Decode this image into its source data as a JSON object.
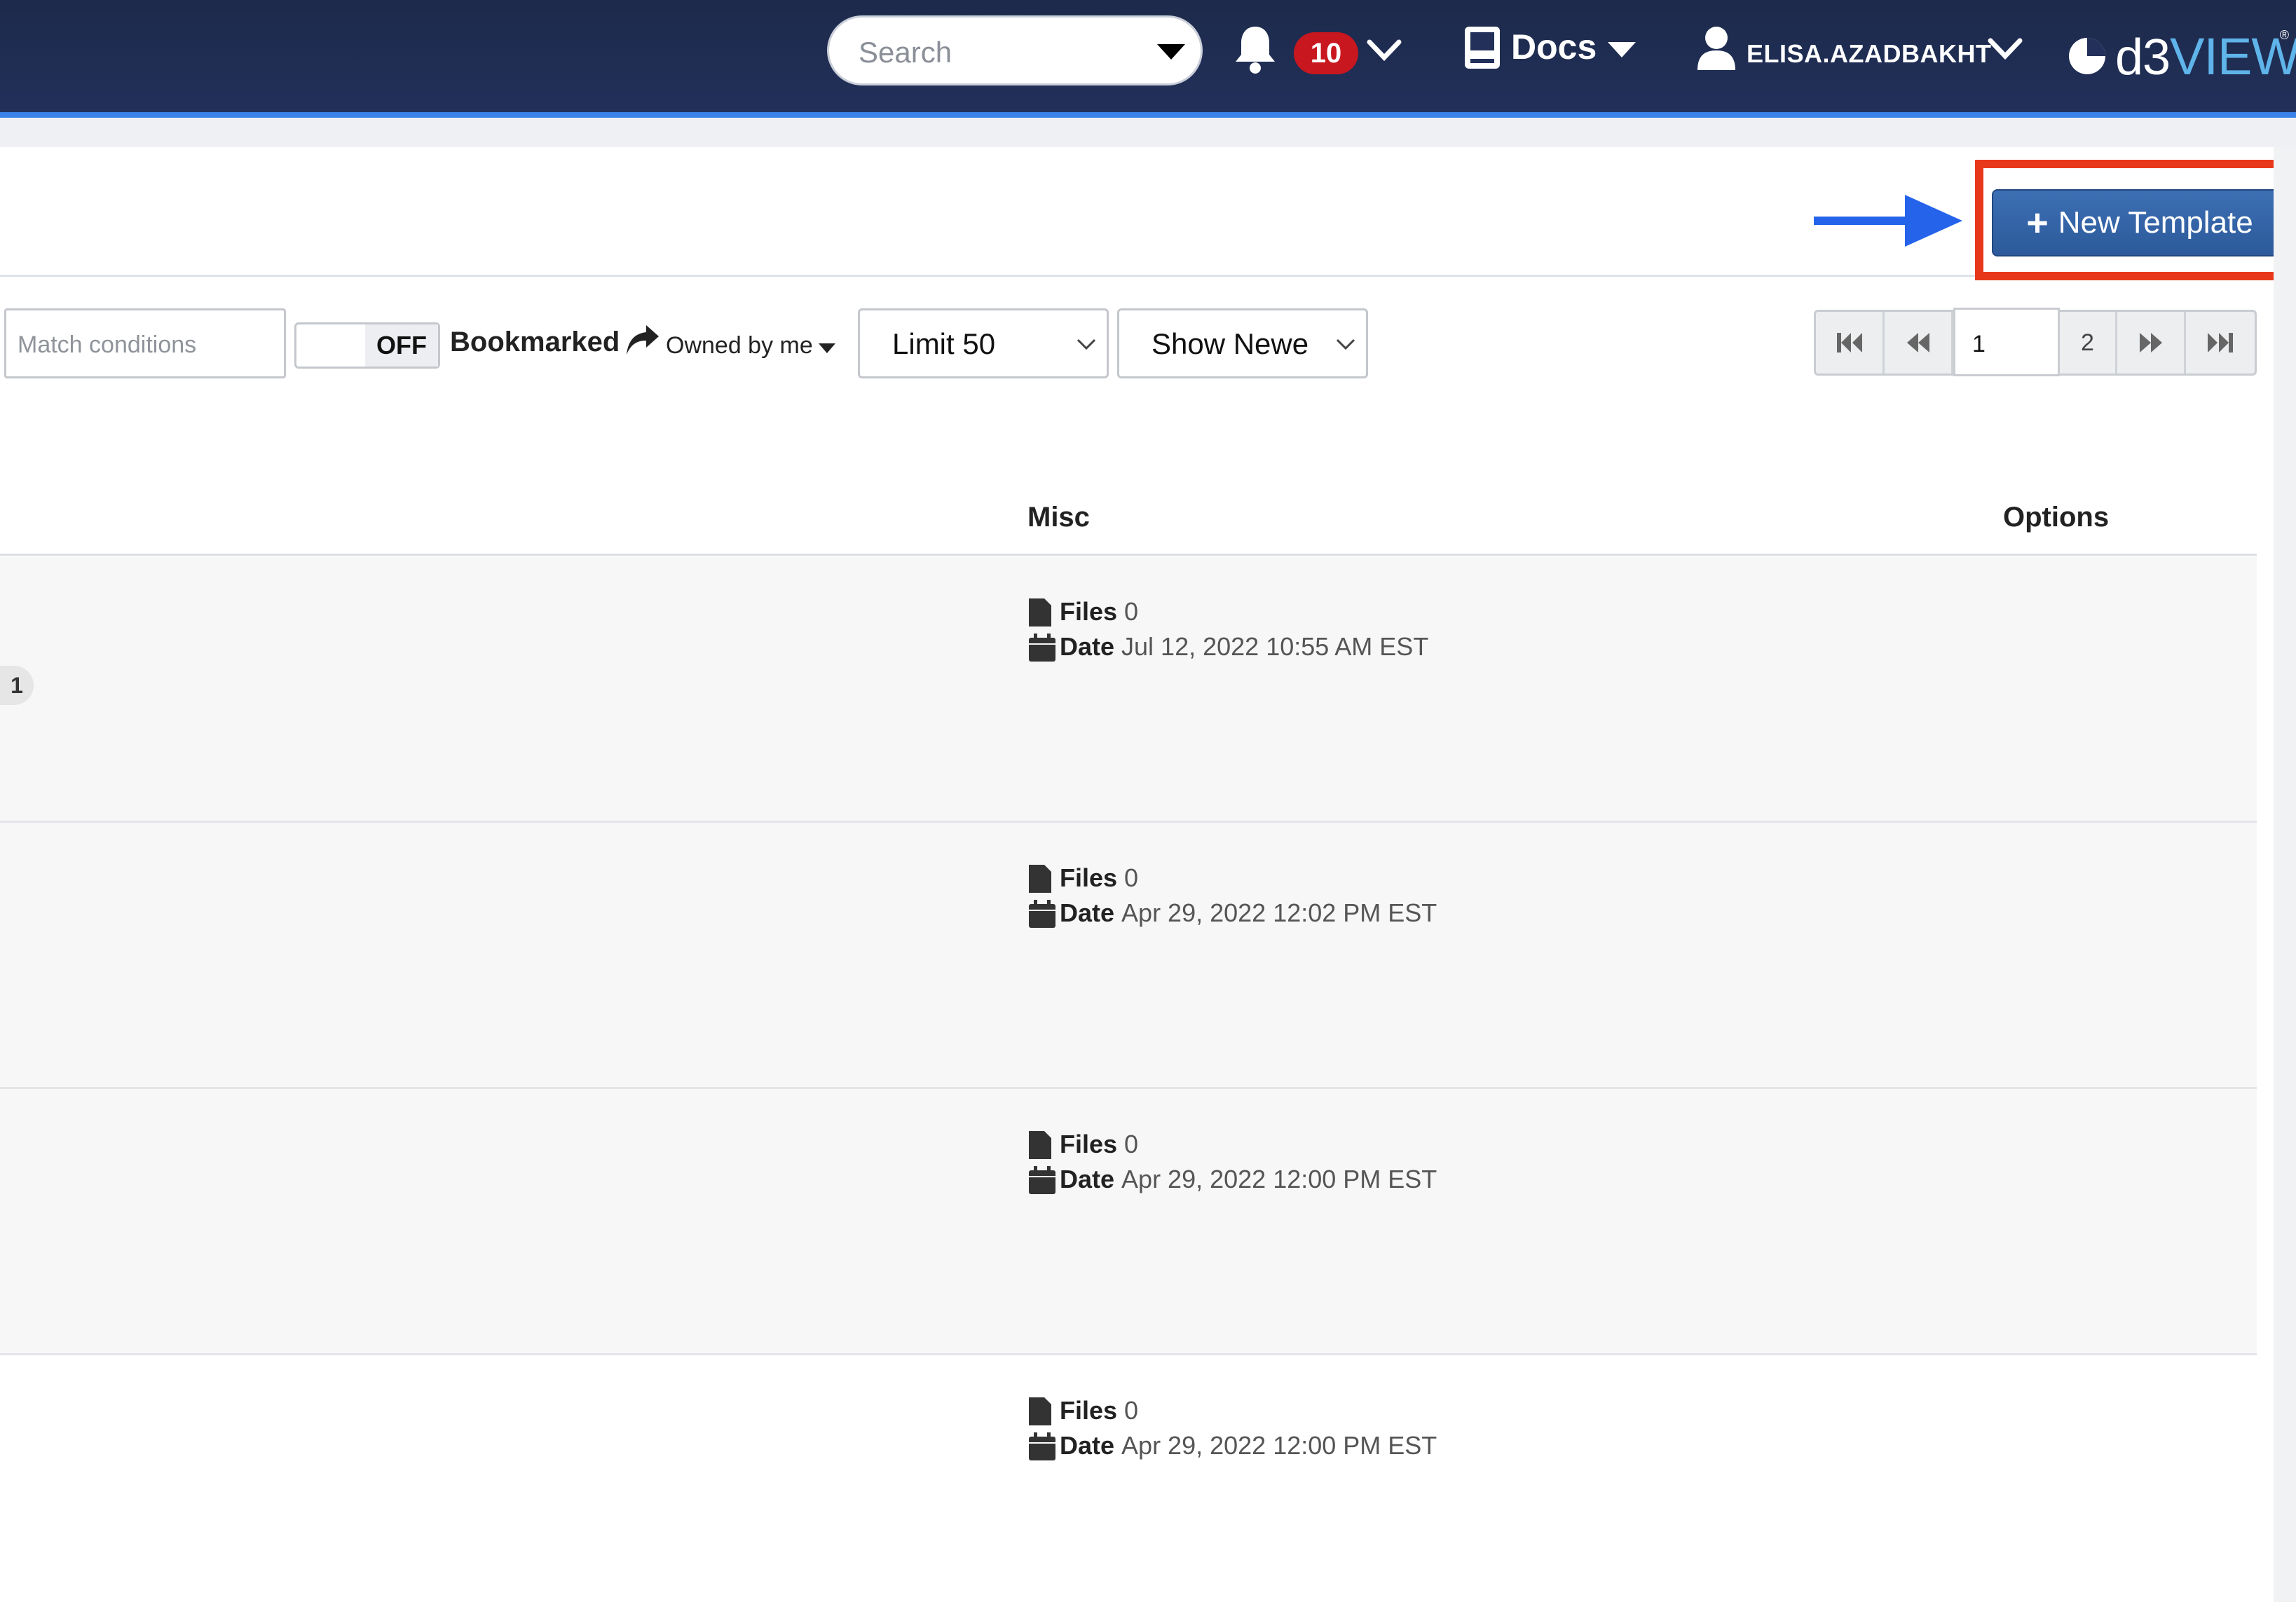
{
  "topbar": {
    "search_placeholder": "Search",
    "notification_count": "10",
    "docs_label": "Docs",
    "username": "ELISA.AZADBAKHT",
    "logo_prefix": "d3",
    "logo_suffix": "VIEW",
    "logo_reg": "®",
    "background": "#1d2a4b",
    "accent": "#3b82e8",
    "badge_color": "#c8171e"
  },
  "header": {
    "new_template_label": "New Template",
    "highlight_color": "#e8381c",
    "arrow_color": "#2563eb"
  },
  "filters": {
    "match_placeholder": "Match conditions",
    "toggle_state": "OFF",
    "bookmarked_label": "Bookmarked",
    "owned_label": "Owned by me",
    "limit_value": "Limit 50",
    "sort_value": "Show Newe"
  },
  "pagination": {
    "current_page": "1",
    "next_page": "2",
    "icons": [
      "first-page-icon",
      "prev-page-icon",
      "next-page-icon",
      "last-page-icon"
    ]
  },
  "table": {
    "columns": {
      "misc": "Misc",
      "options": "Options"
    },
    "files_label": "Files",
    "date_label": "Date",
    "rows": [
      {
        "badge": "1",
        "files": "0",
        "date": "Jul 12, 2022 10:55 AM EST"
      },
      {
        "files": "0",
        "date": "Apr 29, 2022 12:02 PM EST"
      },
      {
        "files": "0",
        "date": "Apr 29, 2022 12:00 PM EST"
      },
      {
        "files": "0",
        "date": "Apr 29, 2022 12:00 PM EST"
      }
    ]
  }
}
